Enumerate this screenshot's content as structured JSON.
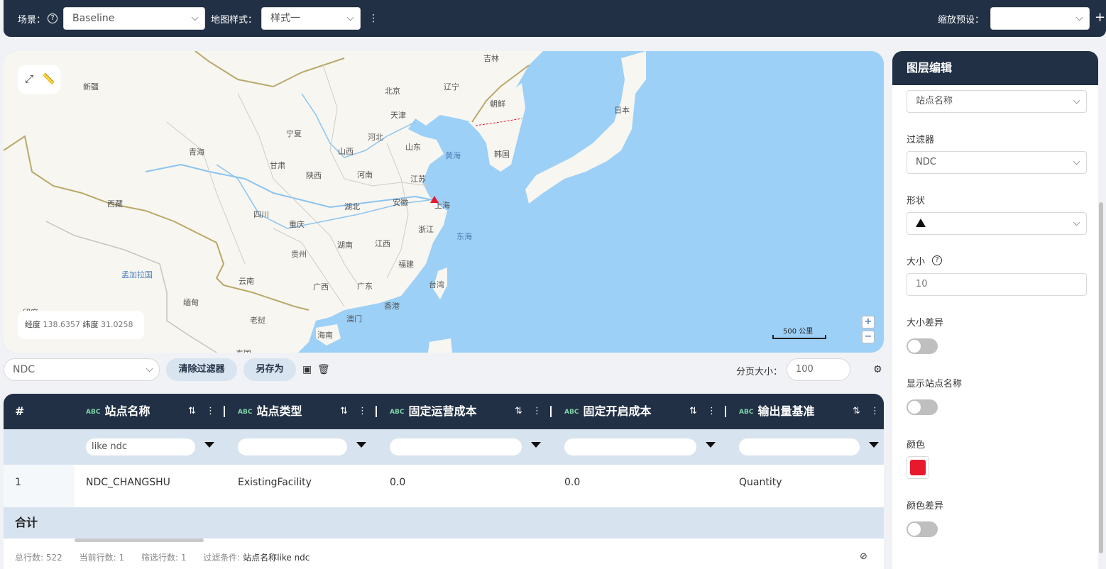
{
  "topbar": {
    "scene_label": "场景：",
    "scene_value": "Baseline",
    "map_style_label": "地图样式：",
    "map_style_value": "样式一",
    "zoom_preset_label": "缩放预设：",
    "zoom_preset_value": "",
    "add_symbol": "+",
    "more_symbol": "⋮",
    "help_symbol": "?"
  },
  "map": {
    "coords": {
      "lng_label": "经度",
      "lng_value": "138.6357",
      "lat_label": "纬度",
      "lat_value": "31.0258"
    },
    "scale_text": "500 公里",
    "zoom_in": "+",
    "zoom_out": "−",
    "labels": {
      "xinjiang": "新疆",
      "jilin": "吉林",
      "liaoning": "辽宁",
      "beijing": "北京",
      "tianjin": "天津",
      "chaoxian": "朝鲜",
      "riben": "日本",
      "ningxia": "宁夏",
      "qinghai": "青海",
      "hebei": "河北",
      "shanxi": "山西",
      "shandong": "山东",
      "huanghai": "黄海",
      "hanguo": "韩国",
      "gansu": "甘肃",
      "shaanxi": "陕西",
      "henan": "河南",
      "jiangsu": "江苏",
      "xizang": "西藏",
      "anhui": "安徽",
      "shanghai": "上海",
      "hubei": "湖北",
      "sichuan": "四川",
      "chongqing": "重庆",
      "zhejiang": "浙江",
      "donghai": "东海",
      "hunan": "湖南",
      "jiangxi": "江西",
      "guizhou": "贵州",
      "fujian": "福建",
      "mengjialaguo": "孟加拉国",
      "yunnan": "云南",
      "taiwan": "台湾",
      "guangxi": "广西",
      "guangdong": "广东",
      "miandian": "缅甸",
      "xianggang": "香港",
      "aomen": "澳门",
      "yindu": "印度",
      "laowo": "老挝",
      "hainan": "海南",
      "taiguo": "泰国"
    }
  },
  "filter_bar": {
    "filter_value": "NDC",
    "clear_filter_button": "清除过滤器",
    "save_as_button": "另存为",
    "page_size_label": "分页大小：",
    "page_size_value": "100"
  },
  "table": {
    "columns": [
      {
        "label": "#"
      },
      {
        "type": "ABC",
        "label": "站点名称",
        "filter": "like ndc"
      },
      {
        "type": "ABC",
        "label": "站点类型",
        "filter": ""
      },
      {
        "type": "ABC",
        "label": "固定运营成本",
        "filter": ""
      },
      {
        "type": "ABC",
        "label": "固定开启成本",
        "filter": ""
      },
      {
        "type": "ABC",
        "label": "输出量基准",
        "filter": ""
      }
    ],
    "rows": [
      {
        "index": "1",
        "name": "NDC_CHANGSHU",
        "type": "ExistingFacility",
        "op_cost": "0.0",
        "open_cost": "0.0",
        "baseline": "Quantity"
      }
    ],
    "sum_label": "合计",
    "footer": {
      "total_label": "总行数:",
      "total_value": "522",
      "current_label": "当前行数:",
      "current_value": "1",
      "filtered_label": "筛选行数:",
      "filtered_value": "1",
      "condition_label": "过滤条件:",
      "condition_field": "站点名称",
      "condition_value": "like ndc"
    }
  },
  "panel": {
    "title": "图层编辑",
    "label_field_value": "站点名称",
    "filter_label": "过滤器",
    "filter_value": "NDC",
    "shape_label": "形状",
    "size_label": "大小",
    "size_value": "10",
    "size_diff_label": "大小差异",
    "show_name_label": "显示站点名称",
    "color_label": "颜色",
    "color_value": "#e8192c",
    "color_diff_label": "颜色差异"
  },
  "colors": {
    "navy": "#213045",
    "sea": "#9dd0f7",
    "land": "#f7f6f1",
    "marker": "#e8192c"
  }
}
